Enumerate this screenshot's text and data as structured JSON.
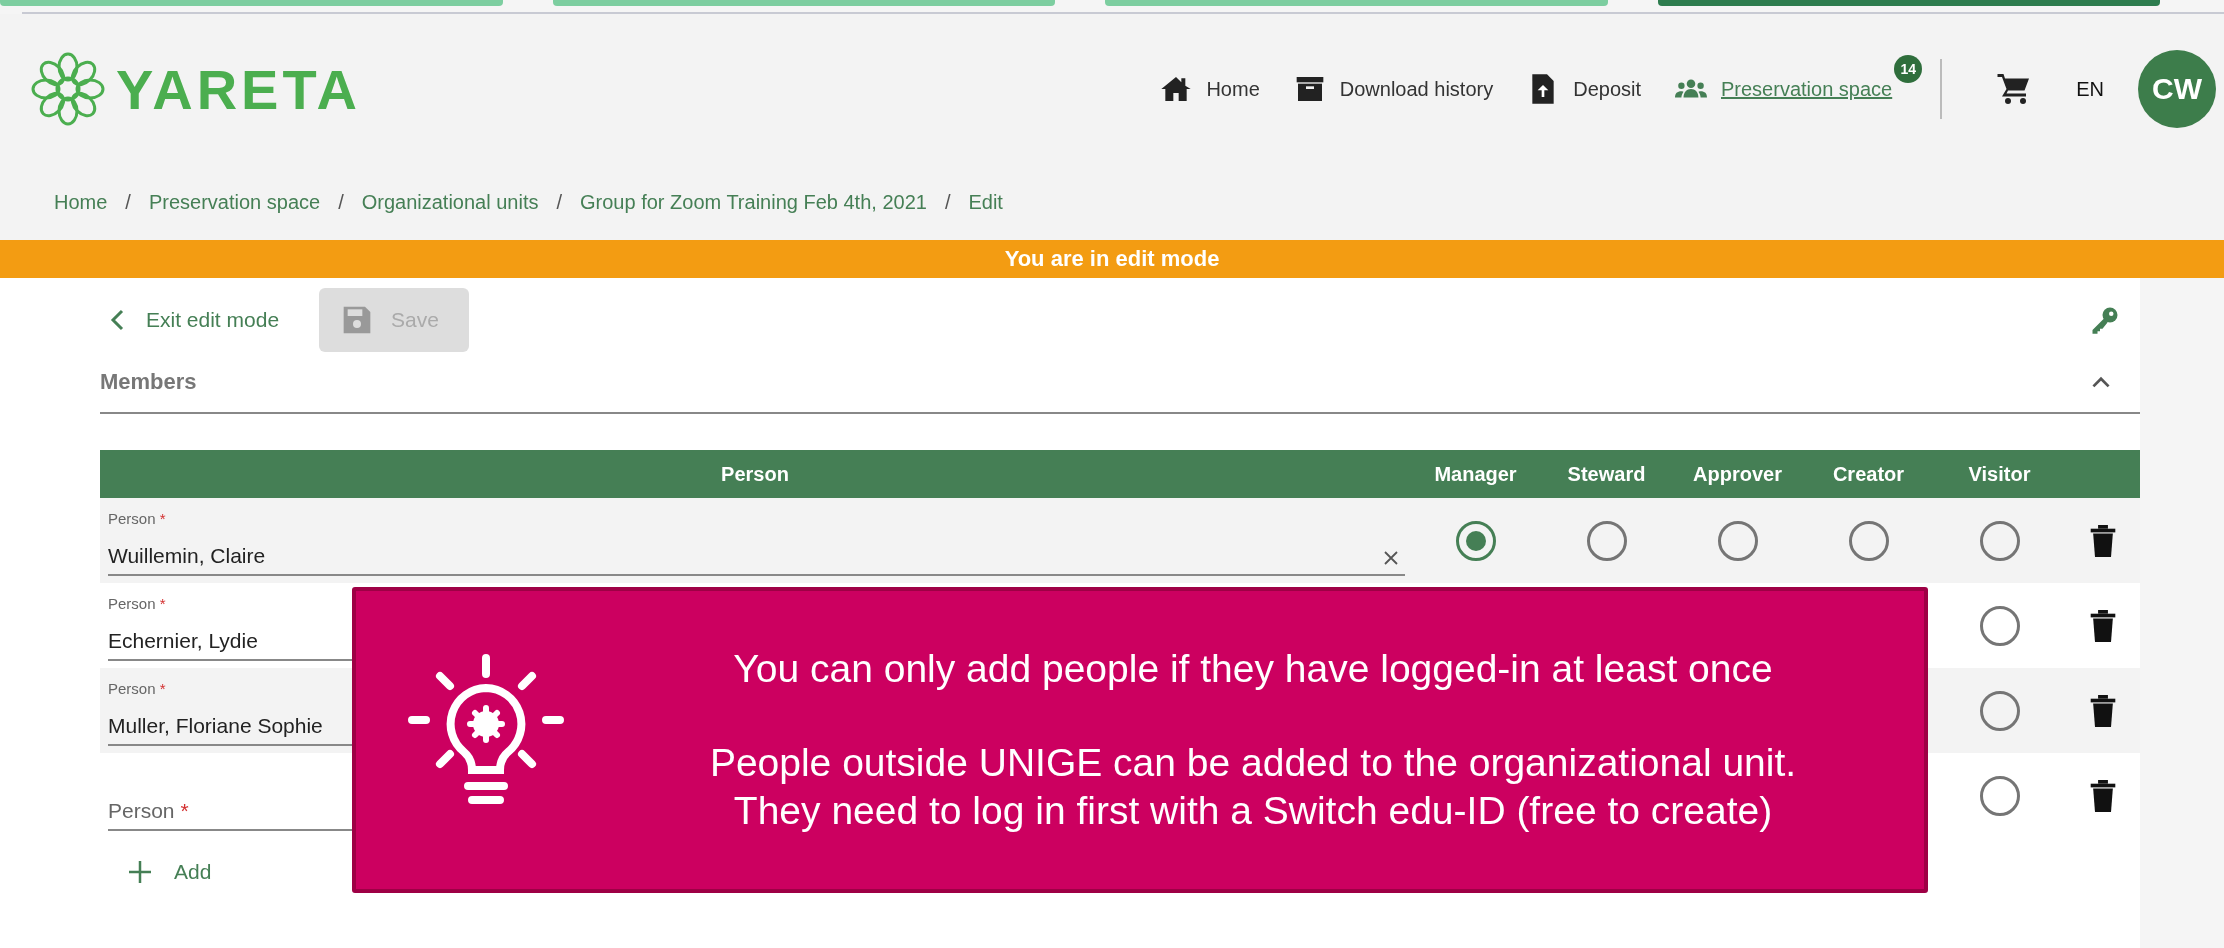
{
  "steps": [
    {
      "selected": false
    },
    {
      "selected": false
    },
    {
      "selected": false
    },
    {
      "selected": true
    }
  ],
  "header": {
    "logo_text": "YARETA",
    "nav": [
      {
        "kind": "home",
        "label": "Home",
        "selected": false
      },
      {
        "kind": "download",
        "label": "Download history",
        "selected": false
      },
      {
        "kind": "deposit",
        "label": "Deposit",
        "selected": false
      },
      {
        "kind": "preservation",
        "label": "Preservation space",
        "selected": true,
        "badge": "14"
      }
    ],
    "language": "EN",
    "avatar": "CW"
  },
  "breadcrumb": [
    {
      "label": "Home",
      "separator": "/"
    },
    {
      "label": "Preservation space",
      "separator": "/"
    },
    {
      "label": "Organizational units",
      "separator": "/"
    },
    {
      "label": "Group for Zoom Training Feb 4th, 2021",
      "separator": "/"
    },
    {
      "label": "Edit"
    }
  ],
  "banner": "You are in edit mode",
  "toolbar": {
    "exit": "Exit edit mode",
    "save": {
      "label": "Save",
      "disabled": true
    }
  },
  "section": {
    "title": "Members",
    "expanded": true
  },
  "table": {
    "columns": [
      "Person",
      "Manager",
      "Steward",
      "Approver",
      "Creator",
      "Visitor"
    ],
    "rows": [
      {
        "label": "Person",
        "required_mark": "*",
        "value": "Wuillemin, Claire",
        "clearable": true,
        "roles": {
          "manager": {
            "selected": true
          },
          "steward": {
            "selected": false
          },
          "approver": {
            "selected": false
          },
          "creator": {
            "selected": false
          },
          "visitor": {
            "selected": false
          }
        }
      },
      {
        "label": "Person",
        "required_mark": "*",
        "value": "Echernier, Lydie",
        "roles": {
          "visitor": {
            "selected": false
          }
        }
      },
      {
        "label": "Person",
        "required_mark": "*",
        "value": "Muller, Floriane Sophie",
        "roles": {
          "visitor": {
            "selected": false
          }
        }
      },
      {
        "placeholder": "Person",
        "placeholder_mark": "*",
        "roles": {
          "visitor": {
            "selected": false
          }
        }
      }
    ]
  },
  "add_button": "Add",
  "callout": {
    "title": "You can only add people if they have logged-in at least once",
    "lines": [
      "People outside UNIGE can be added to the organizational unit.",
      "They need to log in first with a Switch edu-ID (free to create)"
    ]
  }
}
